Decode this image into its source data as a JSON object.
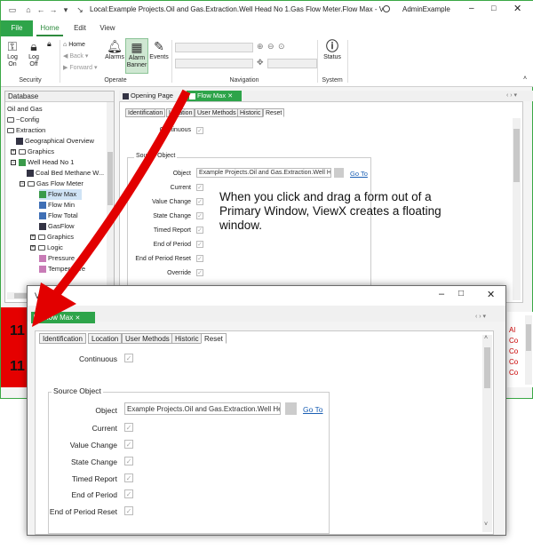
{
  "window": {
    "title": "Local:Example Projects.Oil and Gas.Extraction.Well Head No 1.Gas Flow Meter.Flow Max - Vi...",
    "user": "AdminExample"
  },
  "ribbon": {
    "tabs": [
      "File",
      "Home",
      "Edit",
      "View"
    ],
    "buttons": {
      "log_on": "Log On",
      "log_off": "Log Off",
      "home": "Home",
      "back": "Back",
      "forward": "Forward",
      "alarms": "Alarms",
      "alarm_banner": "Alarm Banner",
      "events": "Events",
      "status": "Status"
    },
    "groups": {
      "security": "Security",
      "operate": "Operate",
      "navigation": "Navigation",
      "system": "System"
    }
  },
  "database": {
    "header": "Database",
    "items": [
      {
        "label": "Oil and Gas"
      },
      {
        "label": "~Config"
      },
      {
        "label": "Extraction"
      },
      {
        "label": "Geographical Overview"
      },
      {
        "label": "Graphics"
      },
      {
        "label": "Well Head No 1"
      },
      {
        "label": "Coal Bed Methane W..."
      },
      {
        "label": "Gas Flow Meter"
      },
      {
        "label": "Flow Max"
      },
      {
        "label": "Flow Min"
      },
      {
        "label": "Flow Total"
      },
      {
        "label": "GasFlow"
      },
      {
        "label": "Graphics"
      },
      {
        "label": "Logic"
      },
      {
        "label": "Pressure"
      },
      {
        "label": "Temperature"
      }
    ]
  },
  "doc_tabs": {
    "opening_page": "Opening Page",
    "flow_max": "Flow Max"
  },
  "form": {
    "tabs": [
      "Identification",
      "Location",
      "User Methods",
      "Historic",
      "Reset"
    ],
    "continuous": "Continuous",
    "source_object": "Source Object",
    "object": "Object",
    "object_value": "Example Projects.Oil and Gas.Extraction.Well Head",
    "go_to": "Go To",
    "fields": [
      "Current",
      "Value Change",
      "State Change",
      "Timed Report",
      "End of Period",
      "End of Period Reset",
      "Override"
    ]
  },
  "annotation": "When you click and drag a form out of a Primary Window, ViewX creates a floating window.",
  "alarm_strip": {
    "numbers": [
      "11",
      "11"
    ],
    "right_letters": [
      "Al",
      "Co",
      "Co",
      "Co",
      "Co"
    ],
    "color": "#e50000"
  },
  "floating": {
    "title": "ViewX",
    "tab": "Flow Max"
  },
  "colors": {
    "accent_green": "#2ea44a",
    "arrow_red": "#e20000",
    "link_blue": "#1a5fb4"
  }
}
